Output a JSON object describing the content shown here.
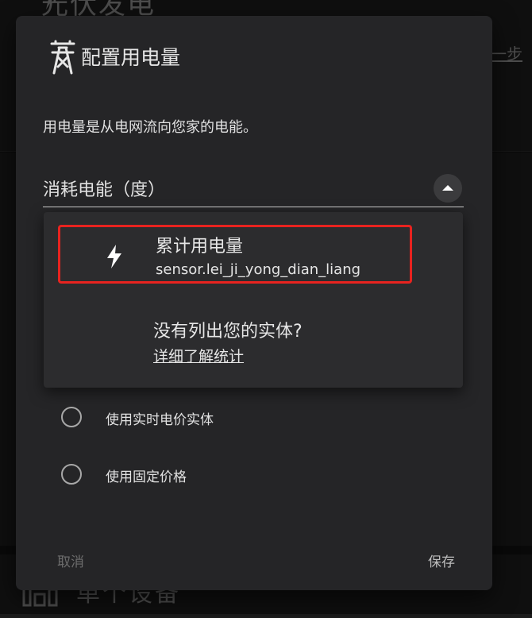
{
  "background": {
    "top_title": "光伏发电",
    "top_link": "一步",
    "bottom_title": "单个设备"
  },
  "dialog": {
    "icon": "transmission-tower-icon",
    "title": "配置用电量",
    "description": "用电量是从电网流向您家的电能。",
    "select": {
      "label": "消耗电能（度）",
      "expanded": true
    },
    "menu": {
      "items": [
        {
          "icon": "flash-icon",
          "title": "累计用电量",
          "entity": "sensor.lei_ji_yong_dian_liang",
          "highlighted": true
        }
      ],
      "help_text": "没有列出您的实体?",
      "help_link": "详细了解统计"
    },
    "radios": [
      {
        "label": "使用实时电价实体",
        "checked": false
      },
      {
        "label": "使用固定价格",
        "checked": false
      }
    ],
    "actions": {
      "cancel": "取消",
      "save": "保存"
    }
  },
  "colors": {
    "dialog_bg": "#252527",
    "menu_bg": "#2c2c2e",
    "highlight": "#e8231f",
    "text": "#e1e1e1",
    "muted": "#6c6c6c"
  }
}
